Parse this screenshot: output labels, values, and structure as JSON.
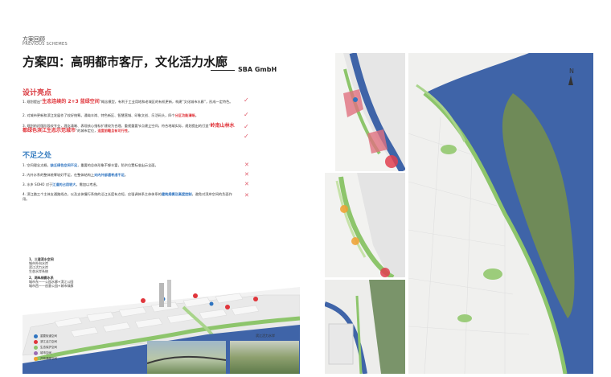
{
  "section": {
    "cn": "方案回顾",
    "en": "PREVIOUS SCHEMES"
  },
  "title": "方案四：高明都市客厅，文化活力水廊",
  "signature": "SBA GmbH",
  "highlights": {
    "heading": "设计亮点",
    "items": [
      {
        "pre": "1. 规划提出“",
        "em": "生态连续的 2+3 蓝绿空间",
        "post": "”概念模型，有利于工业用地和老城区的有机更新，构建“文化城市水廊”，形成一定特色。"
      },
      {
        "pre": "2. 对城市更新和滨江发展作了较好统筹。通坳丰岗、特色新区、智慧营城、印象文创、乐活码头，四个",
        "em": "分区功能清晰",
        "post": "。"
      },
      {
        "pre": "3. 规划的初版阶段较专业，理念清晰、表现核心指标扩建较为合理，重视重要节点建立空间，符合地域实际，规划提出的打造“",
        "em": "岭南山林水都绿色滨江生态示范城市",
        "post": "”的城市定位，",
        "em2": "适度前瞻且有可行性",
        "post2": "。"
      }
    ]
  },
  "shortcomings": {
    "heading": "不足之处",
    "items": [
      {
        "pre": "1. 空间理念太概，",
        "em": "缺乏绿色空间不足",
        "post": "，重要的总体形象不够丰富，防洪位置标准出示全面。"
      },
      {
        "pre": "2. 内外水系的整体统筹较好不足，在整体结构上",
        "em": "对内外部通考虑不足",
        "post": "。"
      },
      {
        "pre": "3. 水乡 SOHO 对于",
        "em": "江道的占用较大",
        "post": "，需加以考虑。"
      },
      {
        "pre": "4. 滨江路三个主体支通路线点，以及支体慢行系统的沿江长度有点短，应强调体系主体体系的",
        "em": "建筑规模及高度控制",
        "post": "，避免对滨岸空间的负面作用。"
      }
    ]
  },
  "axon": {
    "label1": "1、三道滨水空间",
    "sub1": [
      "城市外向水岸",
      "滨江活力水岸",
      "生态水岸系统"
    ],
    "label2": "2、两纵绿廊水系",
    "sub2": [
      "城市东——公园水廊+滨江公园",
      "城市西——创意公园+城市绿廊"
    ],
    "legend": [
      "重要街道空间",
      "滨江活力空间",
      "生态保护空间",
      "城市空间",
      "开放通廊空间"
    ],
    "photo_caption": "滨江活力水岸"
  },
  "colors": {
    "river": "#3f64a8",
    "green": "#8dc56b",
    "island": "#6f8a58",
    "accent": "#e0353b",
    "blue": "#2f74c0"
  }
}
